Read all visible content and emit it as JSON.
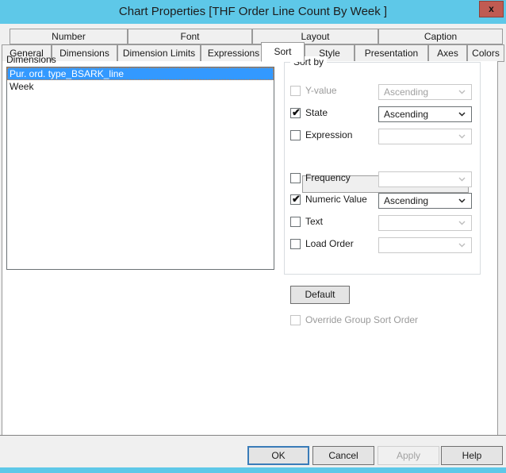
{
  "window": {
    "title": "Chart Properties [THF Order Line Count By Week ]",
    "close_label": "x",
    "titlebar_color": "#5ec8e8",
    "close_color": "#c05b52"
  },
  "tabs": {
    "row1": [
      {
        "label": "Number"
      },
      {
        "label": "Font"
      },
      {
        "label": "Layout"
      },
      {
        "label": "Caption"
      }
    ],
    "row2": [
      {
        "label": "General"
      },
      {
        "label": "Dimensions"
      },
      {
        "label": "Dimension Limits"
      },
      {
        "label": "Expressions"
      },
      {
        "label": "Sort"
      },
      {
        "label": "Style"
      },
      {
        "label": "Presentation"
      },
      {
        "label": "Axes"
      },
      {
        "label": "Colors"
      }
    ],
    "selected": "Sort"
  },
  "dimensions": {
    "label": "Dimensions",
    "items": [
      {
        "label": "Pur. ord. type_BSARK_line",
        "selected": true
      },
      {
        "label": "Week",
        "selected": false
      }
    ],
    "selection_color": "#3399ff"
  },
  "sort_by": {
    "legend": "Sort by",
    "rows": [
      {
        "label": "Y-value",
        "checked": false,
        "enabled": false,
        "combo_value": "Ascending",
        "combo_enabled": false
      },
      {
        "label": "State",
        "checked": true,
        "enabled": true,
        "combo_value": "Ascending",
        "combo_enabled": true
      },
      {
        "label": "Expression",
        "checked": false,
        "enabled": true,
        "combo_value": "",
        "combo_enabled": false
      },
      {
        "label": "Frequency",
        "checked": false,
        "enabled": true,
        "combo_value": "",
        "combo_enabled": false
      },
      {
        "label": "Numeric Value",
        "checked": true,
        "enabled": true,
        "combo_value": "Ascending",
        "combo_enabled": true
      },
      {
        "label": "Text",
        "checked": false,
        "enabled": true,
        "combo_value": "",
        "combo_enabled": false
      },
      {
        "label": "Load Order",
        "checked": false,
        "enabled": true,
        "combo_value": "",
        "combo_enabled": false
      }
    ],
    "expression_value": "",
    "default_button": "Default"
  },
  "override": {
    "label": "Override Group Sort Order",
    "checked": false,
    "enabled": false
  },
  "footer": {
    "ok": "OK",
    "cancel": "Cancel",
    "apply": "Apply",
    "help": "Help"
  }
}
